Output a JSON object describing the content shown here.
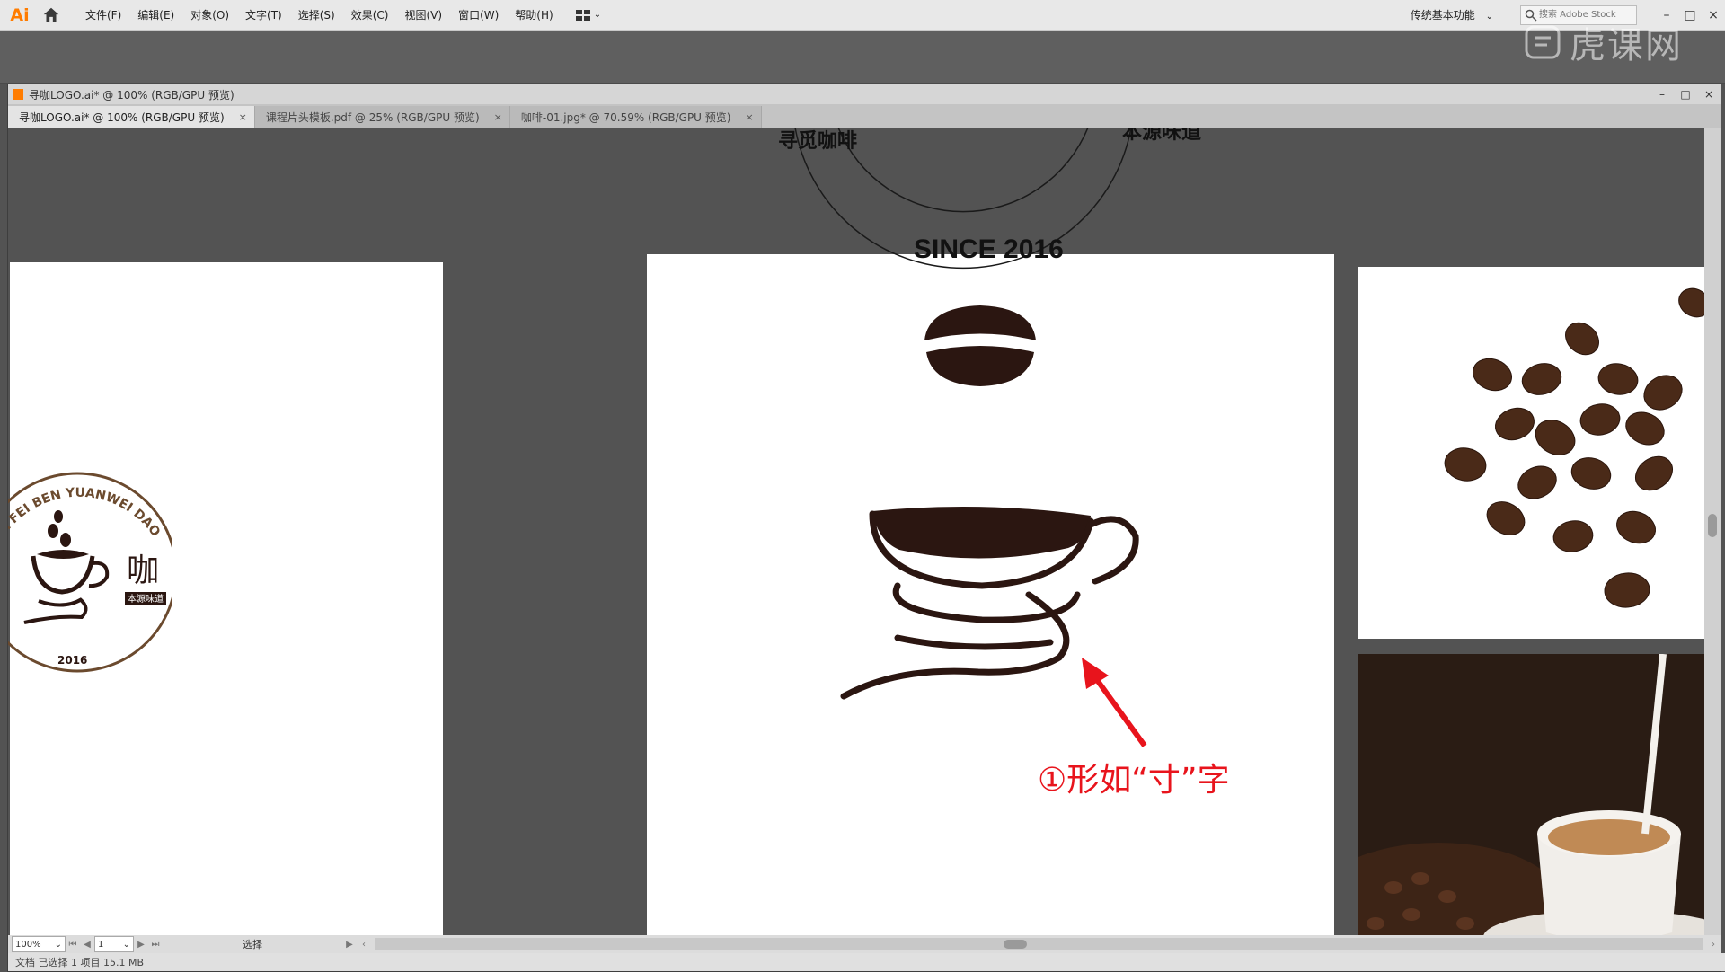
{
  "app": {
    "logo": "Ai",
    "menus": [
      "文件(F)",
      "编辑(E)",
      "对象(O)",
      "文字(T)",
      "选择(S)",
      "效果(C)",
      "视图(V)",
      "窗口(W)",
      "帮助(H)"
    ],
    "workspace": "传统基本功能",
    "search_placeholder": "搜索 Adobe Stock",
    "watermark": "虎课网"
  },
  "document": {
    "title": "寻咖LOGO.ai* @ 100% (RGB/GPU 预览)",
    "tabs": [
      {
        "label": "寻咖LOGO.ai* @ 100% (RGB/GPU 预览)",
        "active": true
      },
      {
        "label": "课程片头模板.pdf @ 25% (RGB/GPU 预览)",
        "active": false
      },
      {
        "label": "咖啡-01.jpg* @ 70.59% (RGB/GPU 预览)",
        "active": false
      }
    ],
    "close_glyph": "×"
  },
  "artwork": {
    "arc_text_left": "寻觅咖啡",
    "arc_text_right": "本源味道",
    "since_text": "SINCE 2016",
    "annotation": "①形如“寸”字",
    "badge_ring_text": "MI KA FEI BEN YUANWEI DAO",
    "badge_char": "咖",
    "badge_sub": "本源味道",
    "badge_year": "2016",
    "brown": "#2b1611",
    "badge_brown": "#6b4a2e",
    "annotation_red": "#e8141c"
  },
  "status": {
    "zoom": "100%",
    "page": "1",
    "tool": "选择",
    "bottom_text": "文档  已选择 1  项目  15.1 MB"
  }
}
